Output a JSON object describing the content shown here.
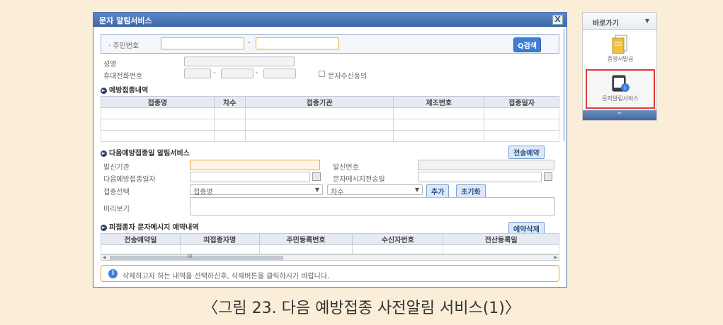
{
  "window": {
    "title": "문자 알림서비스",
    "close_label": "X"
  },
  "search": {
    "resident_no_label": "· 주민번호",
    "separator": "-",
    "search_button": "Q검색"
  },
  "personal": {
    "name_label": "성명",
    "phone_label": "휴대전화번호",
    "phone_sep1": "-",
    "phone_sep2": "-",
    "consent_label": "문자수신동의"
  },
  "vaccination": {
    "section_title": "예방접종내역",
    "columns": [
      "접종명",
      "차수",
      "접종기관",
      "제조번호",
      "접종일자"
    ]
  },
  "next_alert": {
    "section_title": "다음예방접종일 알림서비스",
    "reserve_button": "전송예약",
    "sender_org_label": "발신기관",
    "sender_no_label": "발신번호",
    "next_date_label": "다음예방접종일자",
    "send_date_label": "문자메시지전송일",
    "select_label": "접종선택",
    "vaccine_placeholder": "접종명",
    "dose_placeholder": "차수",
    "add_button": "추가",
    "reset_button": "초기화",
    "preview_label": "미리보기"
  },
  "reservations": {
    "section_title": "피접종자 문자메시지 예약내역",
    "delete_button": "예약삭제",
    "columns": [
      "전송예약일",
      "피접종자명",
      "주민등록번호",
      "수신자번호",
      "전산등록일"
    ],
    "scroll_mark": "III"
  },
  "info": {
    "icon_label": "i",
    "message": "삭제하고자 하는 내역을 선택하신후, 삭제버튼을 클릭하시기 바랍니다."
  },
  "side_panel": {
    "header": "바로가기",
    "items": [
      {
        "label": "증명서발급",
        "icon": "document-icon"
      },
      {
        "label": "문자알림서비스",
        "icon": "phone-message-icon"
      }
    ],
    "collapse_label": "^"
  },
  "caption": "〈그림 23. 다음 예방접종 사전알림 서비스(1)〉"
}
